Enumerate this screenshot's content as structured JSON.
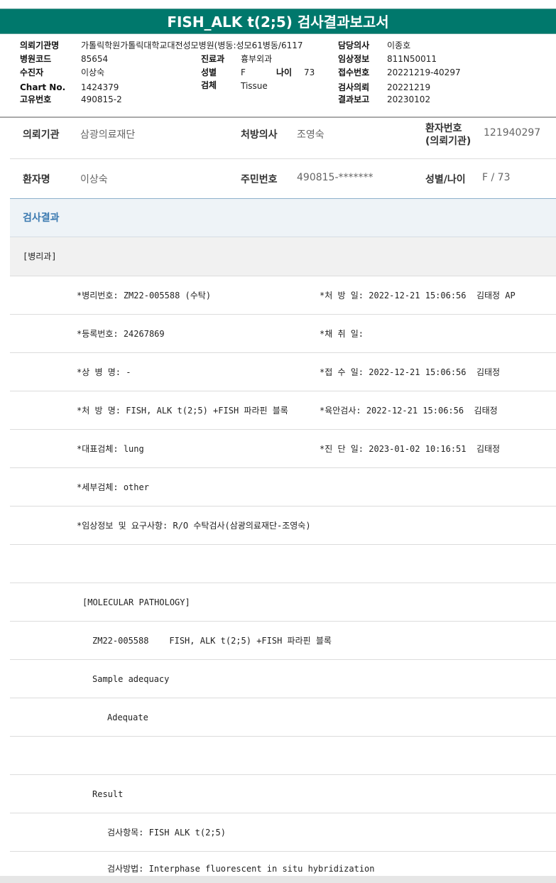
{
  "report": {
    "title": "FISH_ALK t(2;5) 검사결과보고서"
  },
  "header": {
    "institution_label": "의뢰기관명",
    "institution_value": "가톨릭학원가톨릭대학교대전성모병원(병동:성모61병동/6117",
    "physician_label": "담당의사",
    "physician_value": "이종호",
    "hospital_code_label": "병원코드",
    "hospital_code_value": "85654",
    "department_label": "진료과",
    "department_value": "흉부외과",
    "clinical_info_label": "임상정보",
    "clinical_info_value": "811N50011",
    "examinee_label": "수진자",
    "examinee_value": "이상숙",
    "sex_label": "성별",
    "sex_value": "F",
    "age_label": "나이",
    "age_value": "73",
    "receipt_no_label": "접수번호",
    "receipt_no_value": "20221219-40297",
    "chart_no_label": "Chart No.",
    "chart_no_value": "1424379",
    "specimen_label": "검체",
    "specimen_value": "Tissue",
    "request_label": "검사의뢰",
    "request_value": "20221219",
    "unique_no_label": "고유번호",
    "unique_no_value": "490815-2",
    "result_report_label": "결과보고",
    "result_report_value": "20230102"
  },
  "patient": {
    "req_inst_label": "의뢰기관",
    "req_inst_value": "삼광의료재단",
    "presc_doc_label": "처방의사",
    "presc_doc_value": "조영숙",
    "patient_no_label_1": "환자번호",
    "patient_no_label_2": "(의뢰기관)",
    "patient_no_value": "121940297",
    "name_label": "환자명",
    "name_value": "이상숙",
    "rrn_label": "주민번호",
    "rrn_value": "490815-*******",
    "sex_age_label": "성별/나이",
    "sex_age_value": "F / 73"
  },
  "result_section": {
    "heading": "검사결과",
    "department": "[병리과]"
  },
  "details": {
    "pathology_no": "*병리번호: ZM22-005588 (수탁)",
    "prescription_date": "*처 방 일: 2022-12-21 15:06:56  김태정 AP",
    "registration_no": "*등록번호: 24267869",
    "collection_date": "*채 취 일:",
    "disease_name": "*상 병 명: -",
    "receipt_date": "*접 수 일: 2022-12-21 15:06:56  김태정",
    "prescription_name": "*처 방 명: FISH, ALK t(2;5) +FISH 파라핀 블록",
    "gross_exam": "*육안검사: 2022-12-21 15:06:56  김태정",
    "representative_specimen": "*대표검체: lung",
    "diagnosis_date": "*진 단 일: 2023-01-02 10:16:51  김태정",
    "sub_specimen": "*세부검체: other",
    "clinical_request": "*임상정보 및 요구사항: R/O 수탁검사(삼광의료재단-조영숙)"
  },
  "report_body": {
    "molecular_heading": "[MOLECULAR PATHOLOGY]",
    "case_line": "ZM22-005588    FISH, ALK t(2;5) +FISH 파라핀 블록",
    "sample_adequacy": "Sample adequacy",
    "adequate": "Adequate",
    "result": "Result",
    "test_item": "검사항목: FISH ALK t(2;5)",
    "test_method": "검사방법: Interphase fluorescent in situ hybridization"
  }
}
